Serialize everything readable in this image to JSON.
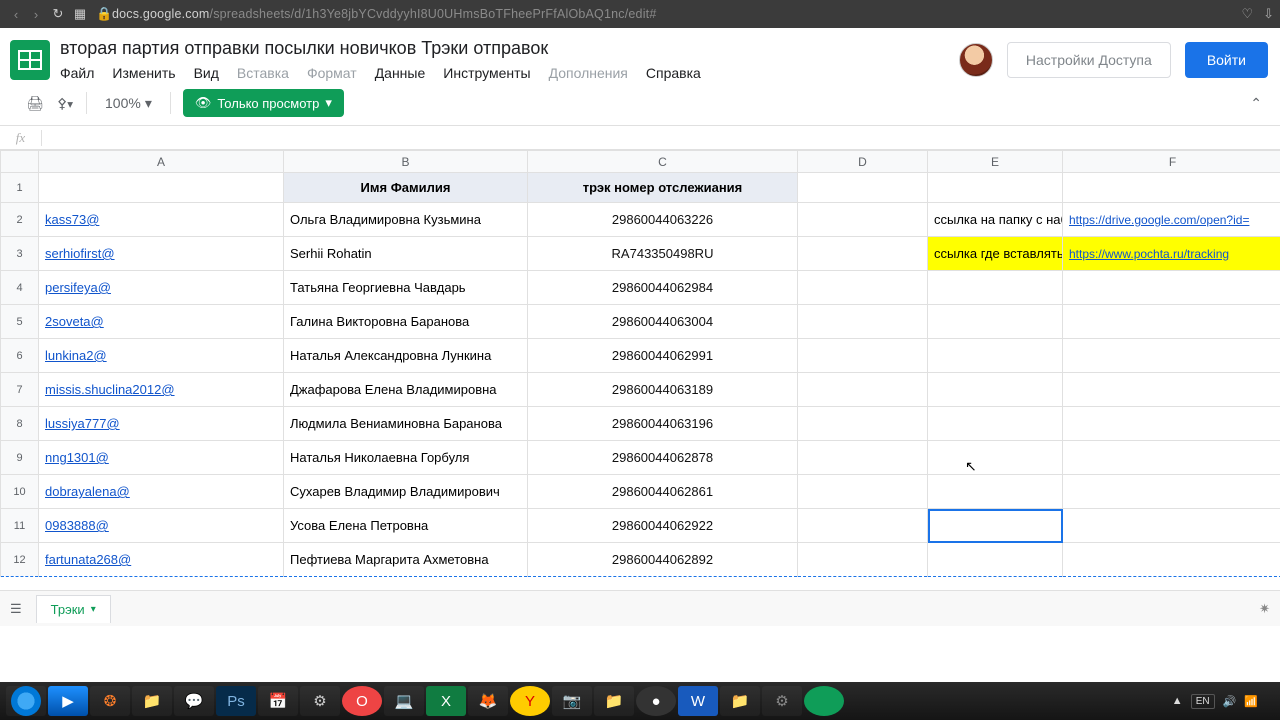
{
  "browser": {
    "url_host": "docs.google.com",
    "url_path": "/spreadsheets/d/1h3Ye8jbYCvddyyhI8U0UHmsBoTFheePrFfAlObAQ1nc/edit#"
  },
  "doc": {
    "title": "вторая партия отправки посылки новичков Трэки отправок"
  },
  "menu": {
    "file": "Файл",
    "edit": "Изменить",
    "view": "Вид",
    "insert": "Вставка",
    "format": "Формат",
    "data": "Данные",
    "tools": "Инструменты",
    "addons": "Дополнения",
    "help": "Справка"
  },
  "header_buttons": {
    "share": "Настройки Доступа",
    "login": "Войти"
  },
  "toolbar": {
    "zoom": "100%",
    "view_only": "Только просмотр"
  },
  "columns": [
    "A",
    "B",
    "C",
    "D",
    "E",
    "F"
  ],
  "headers": {
    "B": "Имя Фамилия",
    "C": "трэк номер отслежиания"
  },
  "side_notes": {
    "E2": "ссылка на папку с набором",
    "F2": "https://drive.google.com/open?id=",
    "E3": "ссылка где вставлять трек код",
    "F3": "https://www.pochta.ru/tracking"
  },
  "rows": [
    {
      "n": 1
    },
    {
      "n": 2,
      "A": "kass73@",
      "B": "Ольга Владимировна Кузьмина",
      "C": "29860044063226"
    },
    {
      "n": 3,
      "A": "serhiofirst@",
      "B": "Serhii Rohatin",
      "C": "RA743350498RU"
    },
    {
      "n": 4,
      "A": "persifeya@",
      "B": "Татьяна Георгиевна Чавдарь",
      "C": "29860044062984"
    },
    {
      "n": 5,
      "A": "2soveta@",
      "B": "Галина Викторовна Баранова",
      "C": "29860044063004"
    },
    {
      "n": 6,
      "A": "lunkina2@",
      "B": "Наталья Александровна Лункина",
      "C": "29860044062991"
    },
    {
      "n": 7,
      "A": "missis.shuclina2012@",
      "B": "Джафарова Елена Владимировна",
      "C": "29860044063189"
    },
    {
      "n": 8,
      "A": "lussiya777@",
      "B": "Людмила Вениаминовна Баранова",
      "C": "29860044063196"
    },
    {
      "n": 9,
      "A": "nng1301@",
      "B": "Наталья Николаевна Горбуля",
      "C": "29860044062878"
    },
    {
      "n": 10,
      "A": "dobrayalena@",
      "B": "Сухарев Владимир Владимирович",
      "C": "29860044062861"
    },
    {
      "n": 11,
      "A": "0983888@",
      "B": "Усова Елена Петровна",
      "C": "29860044062922"
    },
    {
      "n": 12,
      "A": "fartunata268@",
      "B": "Пефтиева Маргарита Ахметовна",
      "C": "29860044062892"
    }
  ],
  "sheet_tab": "Трэки",
  "taskbar": {
    "lang": "EN",
    "time": "",
    "date": ""
  }
}
